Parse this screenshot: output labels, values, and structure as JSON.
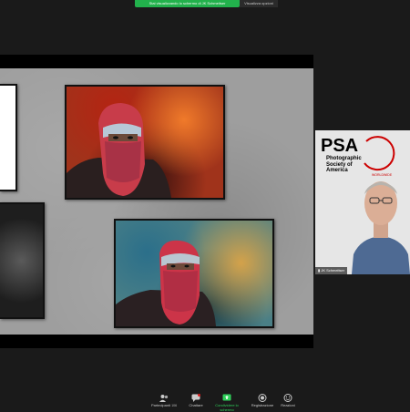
{
  "banner": {
    "share_text": "Stai visualizzando lo schermo di JK Schmeitser",
    "view_options": "Visualizza opzioni"
  },
  "participant": {
    "logo_big": "PSA",
    "logo_line1": "Photographic",
    "logo_line2": "Society of",
    "logo_line3": "America",
    "logo_world": "WORLDWIDE",
    "name": "JK Schmeitser"
  },
  "toolbar": {
    "participants_label": "Partecipanti",
    "participants_count": "106",
    "chat_label": "Chattare",
    "share_label": "Condividere lo schermo",
    "record_label": "Registrazione",
    "reactions_label": "Reazioni"
  },
  "colors": {
    "accent_green": "#22b14c",
    "toolbar_bg": "#1a1a1a"
  }
}
